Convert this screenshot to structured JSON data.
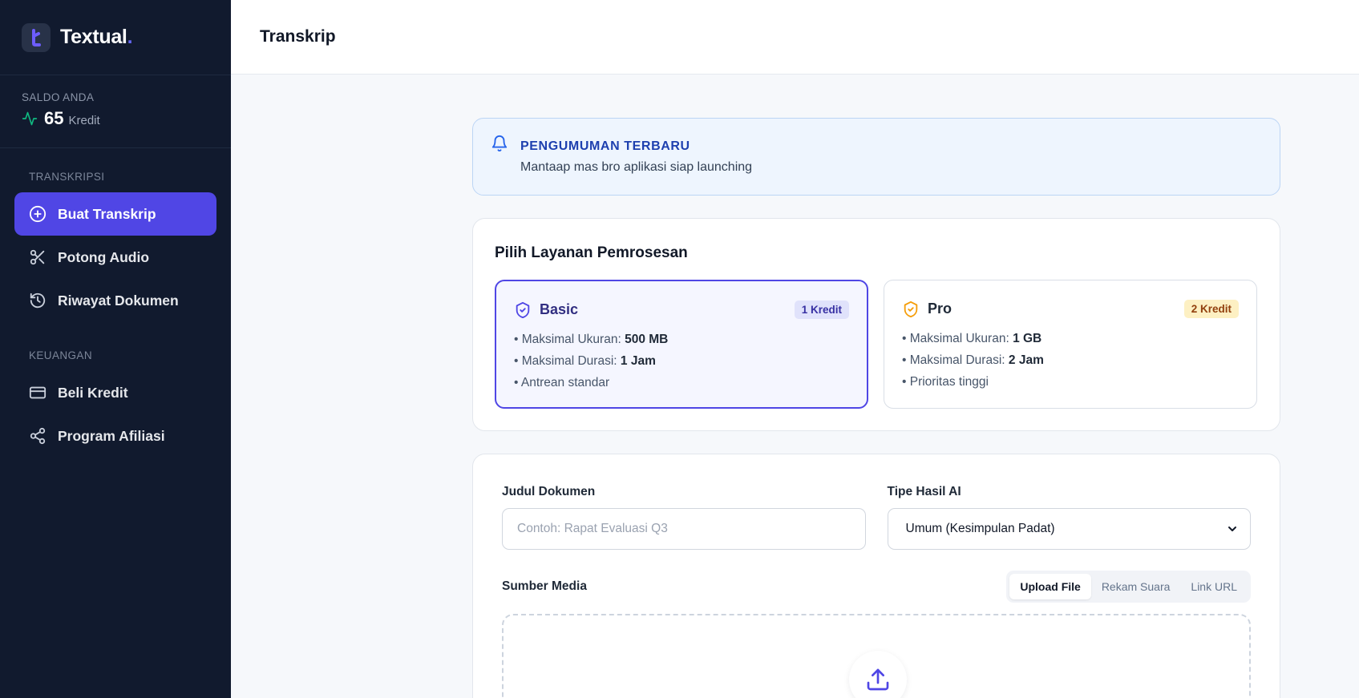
{
  "app": {
    "name": "Textual",
    "name_dot": "."
  },
  "balance": {
    "label": "SALDO ANDA",
    "amount": "65",
    "unit": "Kredit"
  },
  "sidebar": {
    "sections": [
      {
        "label": "TRANSKRIPSI",
        "items": [
          {
            "label": "Buat Transkrip",
            "icon": "plus-circle-icon",
            "active": true
          },
          {
            "label": "Potong Audio",
            "icon": "scissors-icon"
          },
          {
            "label": "Riwayat Dokumen",
            "icon": "history-icon"
          }
        ]
      },
      {
        "label": "KEUANGAN",
        "items": [
          {
            "label": "Beli Kredit",
            "icon": "credit-card-icon"
          },
          {
            "label": "Program Afiliasi",
            "icon": "share-icon"
          }
        ]
      }
    ]
  },
  "header": {
    "title": "Transkrip"
  },
  "announcement": {
    "title": "PENGUMUMAN TERBARU",
    "message": "Mantaap mas bro aplikasi siap launching",
    "icon": "bell-icon"
  },
  "service": {
    "title": "Pilih Layanan Pemrosesan",
    "plans": [
      {
        "name": "Basic",
        "badge": "1 Kredit",
        "selected": true,
        "icon": "shield-check-icon",
        "features": [
          {
            "prefix": "• Maksimal Ukuran: ",
            "value": "500 MB"
          },
          {
            "prefix": "• Maksimal Durasi: ",
            "value": "1 Jam"
          },
          {
            "prefix": "• Antrean standar",
            "value": ""
          }
        ]
      },
      {
        "name": "Pro",
        "badge": "2 Kredit",
        "selected": false,
        "icon": "shield-check-icon",
        "features": [
          {
            "prefix": "• Maksimal Ukuran: ",
            "value": "1 GB"
          },
          {
            "prefix": "• Maksimal Durasi: ",
            "value": "2 Jam"
          },
          {
            "prefix": "• Prioritas tinggi",
            "value": ""
          }
        ]
      }
    ]
  },
  "form": {
    "title_label": "Judul Dokumen",
    "title_placeholder": "Contoh: Rapat Evaluasi Q3",
    "ai_type_label": "Tipe Hasil AI",
    "ai_type_value": "Umum (Kesimpulan Padat)",
    "media_label": "Sumber Media",
    "media_tabs": [
      {
        "label": "Upload File",
        "active": true
      },
      {
        "label": "Rekam Suara",
        "active": false
      },
      {
        "label": "Link URL",
        "active": false
      }
    ]
  },
  "colors": {
    "sidebar_bg": "#111a2e",
    "accent": "#5046e5",
    "pro_accent": "#f59e0b",
    "announce_bg": "#eef5fe"
  }
}
